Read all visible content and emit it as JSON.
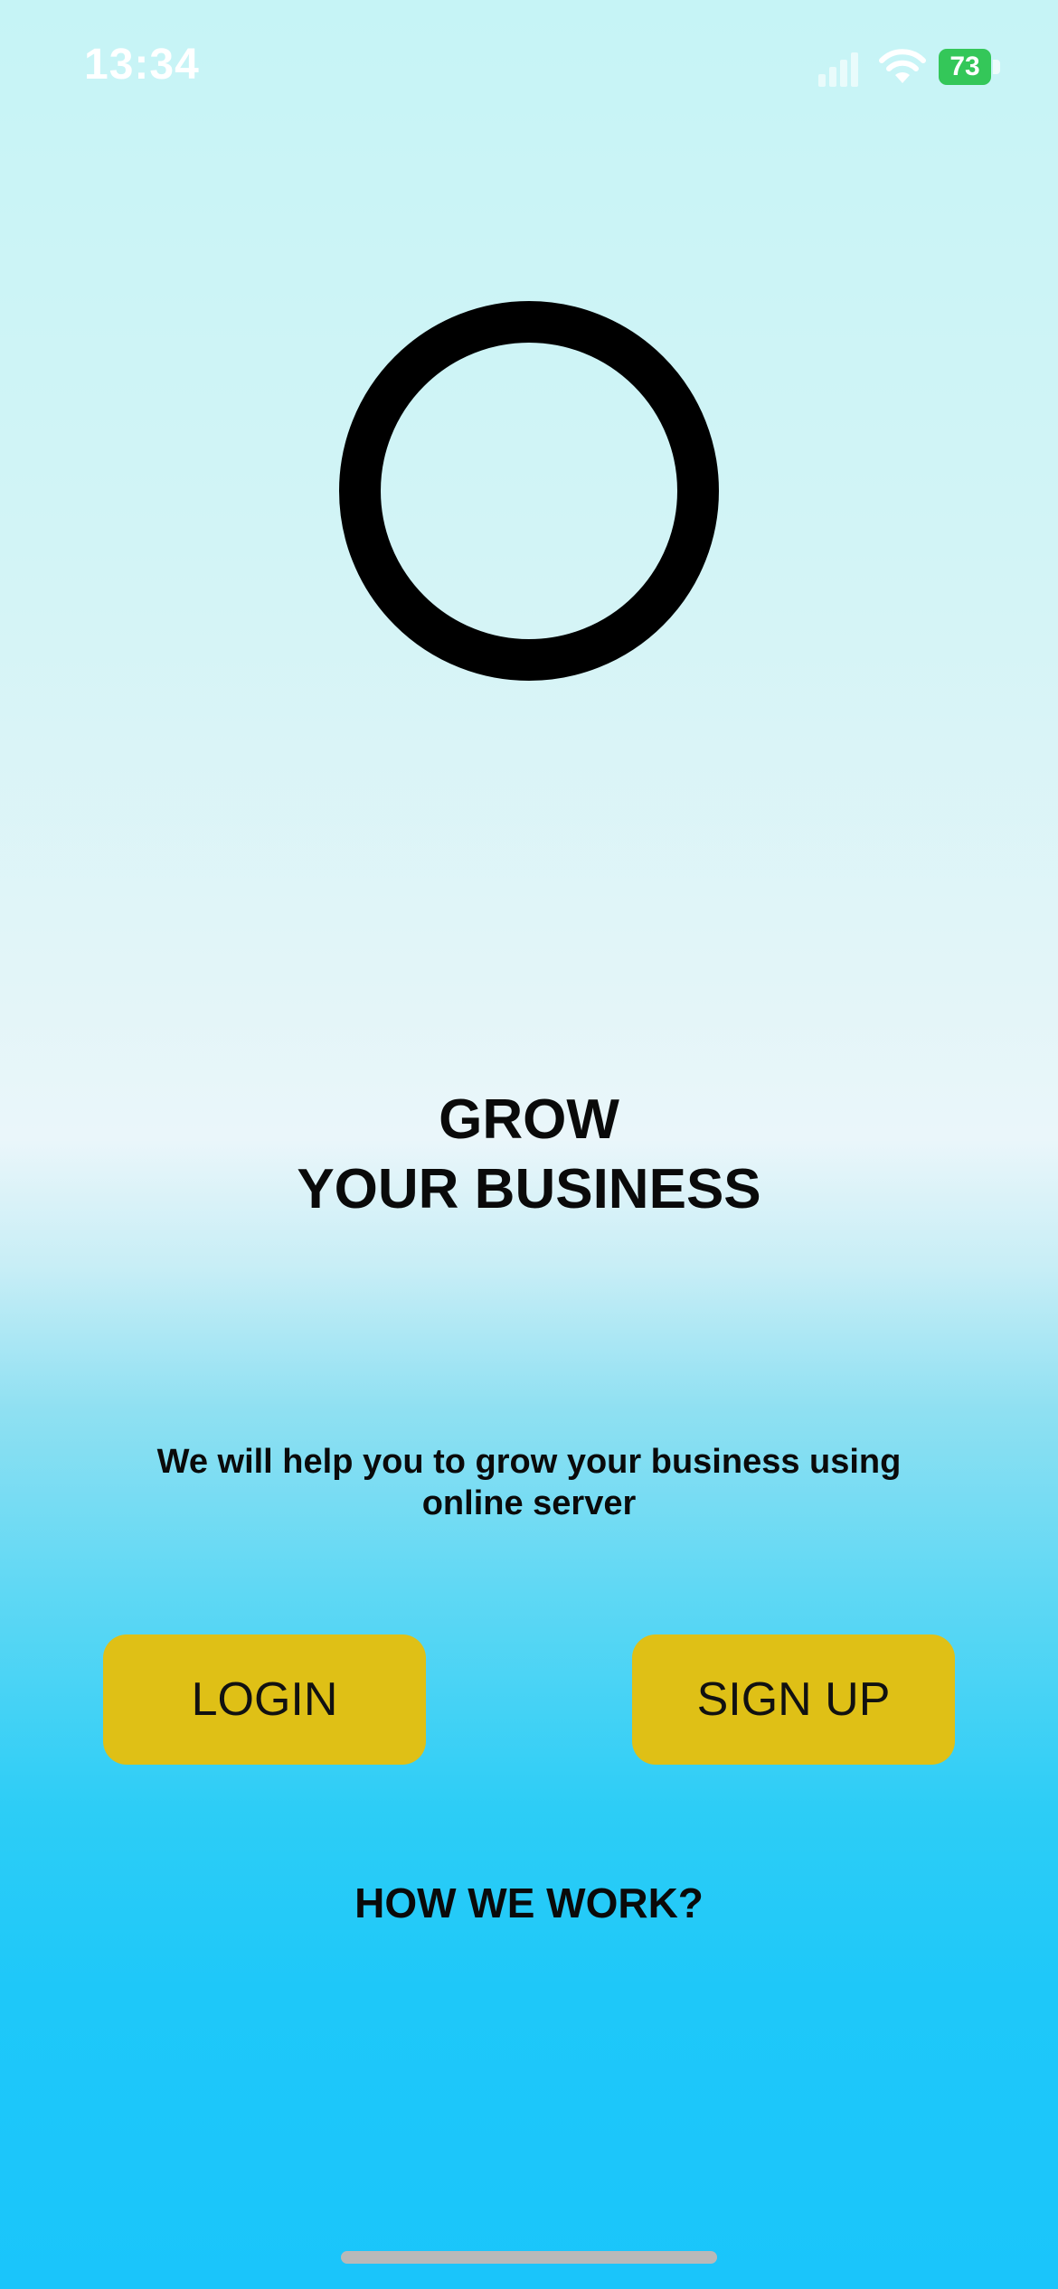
{
  "status_bar": {
    "time": "13:34",
    "battery": "73",
    "icons": [
      "signal-icon",
      "wifi-icon",
      "battery-icon"
    ],
    "battery_color": "#34c759"
  },
  "hero": {
    "logo_icon": "ring-logo",
    "headline_line1": "GROW",
    "headline_line2": "YOUR BUSINESS",
    "subtitle": "We will help you to grow your business using online server"
  },
  "actions": {
    "login_label": "LOGIN",
    "signup_label": "SIGN UP",
    "button_color": "#dfc016"
  },
  "footer": {
    "how_label": "HOW WE WORK?"
  }
}
